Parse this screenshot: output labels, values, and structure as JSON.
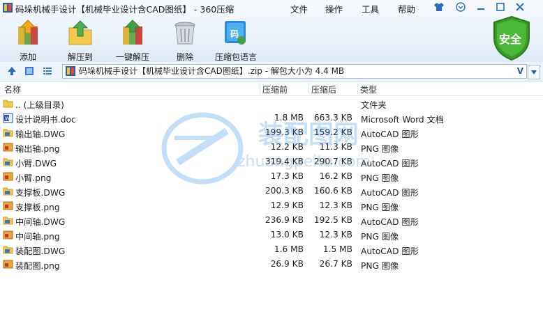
{
  "window": {
    "title": "码垛机械手设计【机械毕业设计含CAD图纸】 - 360压缩",
    "menu": [
      "文件",
      "操作",
      "工具",
      "帮助"
    ]
  },
  "toolbar": {
    "buttons": [
      {
        "label": "添加",
        "icon": "add-archive-icon"
      },
      {
        "label": "解压到",
        "icon": "extract-to-icon"
      },
      {
        "label": "一键解压",
        "icon": "one-click-extract-icon"
      },
      {
        "label": "删除",
        "icon": "delete-trash-icon"
      },
      {
        "label": "压缩包语言",
        "icon": "archive-language-icon"
      }
    ],
    "security_badge": "安全",
    "lang_glyph": "码"
  },
  "address": {
    "path": "码垛机械手设计【机械毕业设计含CAD图纸】.zip - 解包大小为 4.4 MB",
    "chevron": "V"
  },
  "columns": {
    "name": "名称",
    "packed": "压缩前",
    "unpacked": "压缩后",
    "type": "类型"
  },
  "files": [
    {
      "name": ".. (上级目录)",
      "size": "",
      "packed": "",
      "type": "文件夹",
      "icon": "folder-icon"
    },
    {
      "name": "设计说明书.doc",
      "size": "1.8 MB",
      "packed": "663.3 KB",
      "type": "Microsoft Word 文档",
      "icon": "word-doc-icon"
    },
    {
      "name": "输出轴.DWG",
      "size": "199.3 KB",
      "packed": "159.2 KB",
      "type": "AutoCAD 图形",
      "icon": "dwg-file-icon"
    },
    {
      "name": "输出轴.png",
      "size": "12.2 KB",
      "packed": "11.3 KB",
      "type": "PNG 图像",
      "icon": "png-image-icon"
    },
    {
      "name": "小臂.DWG",
      "size": "319.4 KB",
      "packed": "290.7 KB",
      "type": "AutoCAD 图形",
      "icon": "dwg-file-icon"
    },
    {
      "name": "小臂.png",
      "size": "17.3 KB",
      "packed": "16.2 KB",
      "type": "PNG 图像",
      "icon": "png-image-icon"
    },
    {
      "name": "支撑板.DWG",
      "size": "200.3 KB",
      "packed": "160.6 KB",
      "type": "AutoCAD 图形",
      "icon": "dwg-file-icon"
    },
    {
      "name": "支撑板.png",
      "size": "12.9 KB",
      "packed": "12.3 KB",
      "type": "PNG 图像",
      "icon": "png-image-icon"
    },
    {
      "name": "中间轴.DWG",
      "size": "236.9 KB",
      "packed": "192.5 KB",
      "type": "AutoCAD 图形",
      "icon": "dwg-file-icon"
    },
    {
      "name": "中间轴.png",
      "size": "13.0 KB",
      "packed": "12.3 KB",
      "type": "PNG 图像",
      "icon": "png-image-icon"
    },
    {
      "name": "装配图.DWG",
      "size": "1.6 MB",
      "packed": "1.5 MB",
      "type": "AutoCAD 图形",
      "icon": "dwg-file-icon"
    },
    {
      "name": "装配图.png",
      "size": "26.9 KB",
      "packed": "26.7 KB",
      "type": "PNG 图像",
      "icon": "png-image-icon"
    }
  ],
  "watermark": {
    "cn": "装配图网",
    "en": "zhuangpeitu.com"
  },
  "colors": {
    "accent": "#2b6cc4",
    "shield": "#3a9a2a",
    "header_bg": "#e9f2fb"
  }
}
